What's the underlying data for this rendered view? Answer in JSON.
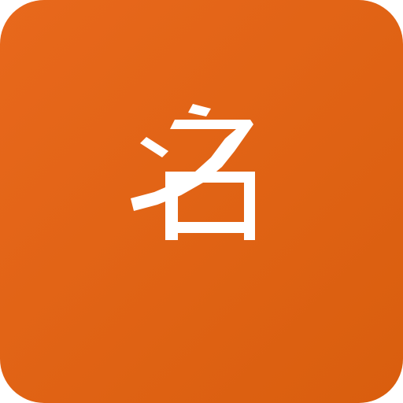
{
  "icon": {
    "glyph": "名",
    "background_color_start": "#e8681c",
    "background_color_end": "#d95e0e",
    "glyph_color": "#ffffff"
  }
}
